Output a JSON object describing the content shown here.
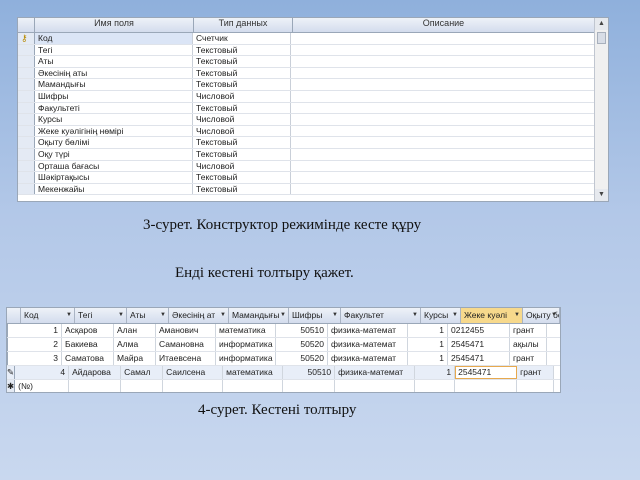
{
  "design_view": {
    "headers": {
      "field_name": "Имя поля",
      "data_type": "Тип данных",
      "description": "Описание"
    },
    "rows": [
      {
        "name": "Код",
        "type": "Счетчик",
        "key": true
      },
      {
        "name": "Тегі",
        "type": "Текстовый"
      },
      {
        "name": "Аты",
        "type": "Текстовый"
      },
      {
        "name": "Әкесінің аты",
        "type": "Текстовый"
      },
      {
        "name": "Мамандығы",
        "type": "Текстовый"
      },
      {
        "name": "Шифры",
        "type": "Числовой"
      },
      {
        "name": "Факультеті",
        "type": "Текстовый"
      },
      {
        "name": "Курсы",
        "type": "Числовой"
      },
      {
        "name": "Жеке куәлігінің нөмірі",
        "type": "Числовой"
      },
      {
        "name": "Оқыту бөлімі",
        "type": "Текстовый"
      },
      {
        "name": "Оқу түрі",
        "type": "Текстовый"
      },
      {
        "name": "Орташа бағасы",
        "type": "Числовой"
      },
      {
        "name": "Шәкіртақысы",
        "type": "Текстовый"
      },
      {
        "name": "Мекенжайы",
        "type": "Текстовый"
      }
    ],
    "key_icon": "key-icon"
  },
  "captions": {
    "fig3": "3-сурет. Конструктор режимінде кесте құру",
    "middle": "Енді кестені толтыру қажет.",
    "fig4": "4-сурет. Кестені толтыру"
  },
  "datasheet": {
    "headers": [
      "Код",
      "Тегі",
      "Аты",
      "Әкесінің ат",
      "Мамандығы",
      "Шифры",
      "Факультет",
      "Курсы",
      "Жеке куәлі",
      "Оқыту бө"
    ],
    "rows": [
      [
        "1",
        "Асқаров",
        "Алан",
        "Аманович",
        "математика",
        "50510",
        "физика-математ",
        "1",
        "0212455",
        "грант"
      ],
      [
        "2",
        "Бакиева",
        "Алма",
        "Самановна",
        "информатика",
        "50520",
        "физика-математ",
        "1",
        "2545471",
        "ақылы"
      ],
      [
        "3",
        "Саматова",
        "Майра",
        "Итаевсена",
        "информатика",
        "50520",
        "физика-математ",
        "1",
        "2545471",
        "грант"
      ],
      [
        "4",
        "Айдарова",
        "Самал",
        "Саилсена",
        "математика",
        "50510",
        "физика-математ",
        "1",
        "2545471",
        "грант"
      ]
    ],
    "new_row_label": "(№)",
    "pencil_icon": "pencil-icon",
    "new_row_icon": "asterisk-icon",
    "highlight_color": "#f7d98c"
  }
}
